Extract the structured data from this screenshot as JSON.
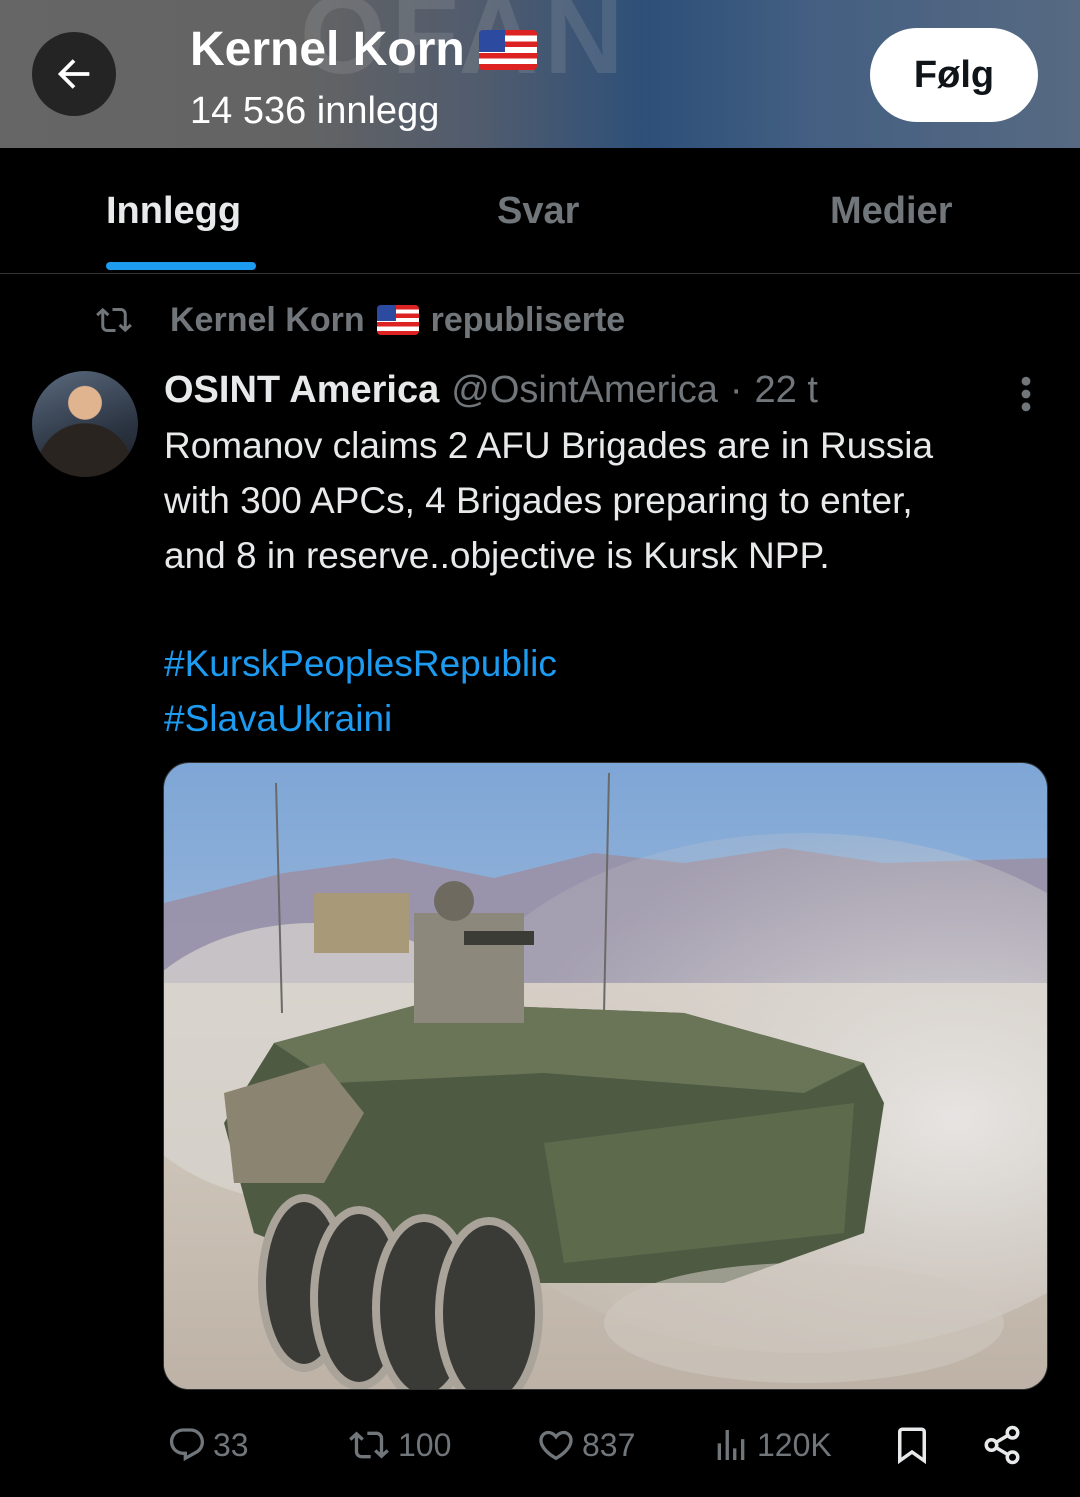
{
  "header": {
    "title": "Kernel Korn",
    "posts_count": "14 536 innlegg",
    "follow_label": "Følg",
    "banner_text": "OFAN"
  },
  "tabs": [
    {
      "label": "Innlegg",
      "active": true
    },
    {
      "label": "Svar",
      "active": false
    },
    {
      "label": "Medier",
      "active": false
    }
  ],
  "repost": {
    "user": "Kernel Korn",
    "action": "republiserte"
  },
  "post": {
    "author_name": "OSINT America",
    "handle": "@OsintAmerica",
    "separator": "·",
    "time": "22 t",
    "text_lines": [
      "Romanov claims 2 AFU Brigades are in Russia",
      "with 300 APCs, 4 Brigades preparing to enter,",
      "and 8 in reserve..objective is Kursk NPP."
    ],
    "hashtags": [
      "#KurskPeoplesRepublic",
      "#SlavaUkraini"
    ]
  },
  "actions": {
    "replies": "33",
    "reposts": "100",
    "likes": "837",
    "views": "120K"
  },
  "colors": {
    "background": "#000000",
    "text": "#e7e9ea",
    "muted": "#71767b",
    "accent": "#1d9bf0",
    "divider": "#2f3336"
  },
  "icons": [
    "back-arrow-icon",
    "flag-us-icon",
    "repost-icon",
    "more-vertical-icon",
    "reply-icon",
    "like-icon",
    "views-icon",
    "bookmark-icon",
    "share-icon"
  ]
}
